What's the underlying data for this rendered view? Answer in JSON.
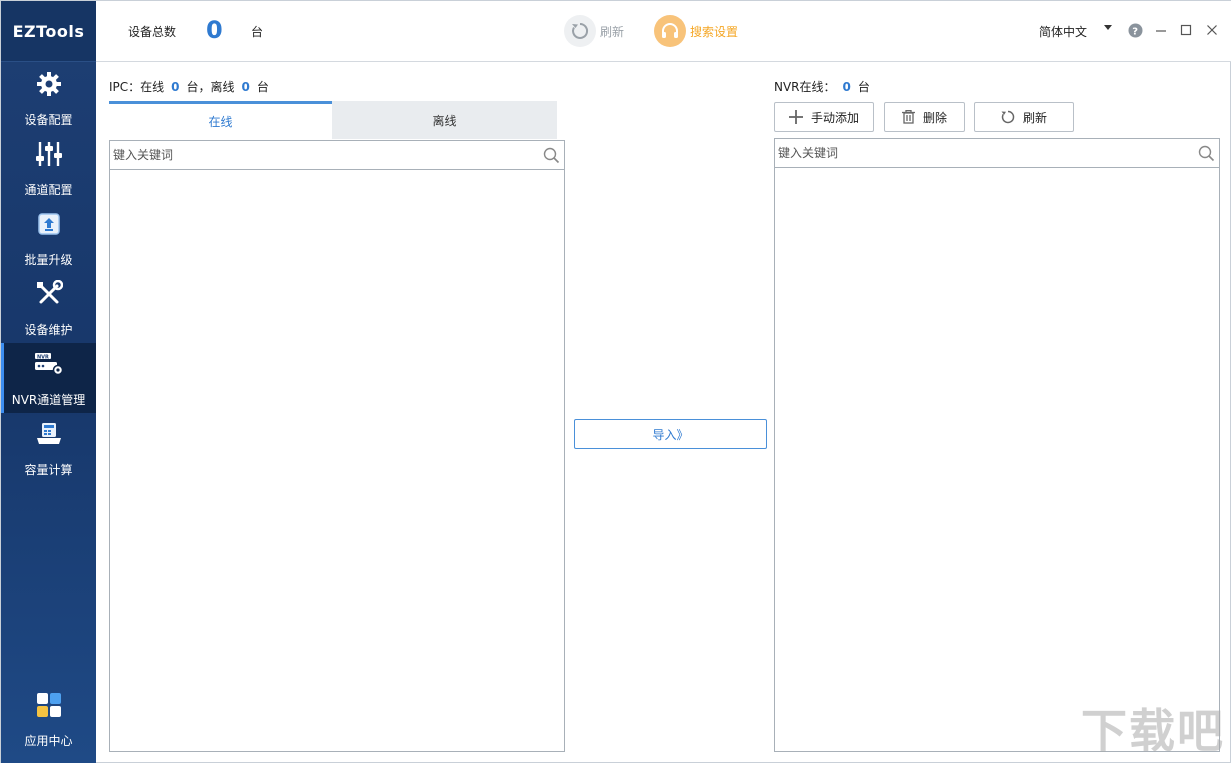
{
  "app": {
    "logo": "EZTools"
  },
  "sidebar": {
    "items": [
      {
        "label": "设备配置",
        "icon": "gear-icon"
      },
      {
        "label": "通道配置",
        "icon": "sliders-icon"
      },
      {
        "label": "批量升级",
        "icon": "upgrade-icon"
      },
      {
        "label": "设备维护",
        "icon": "tools-icon"
      },
      {
        "label": "NVR通道管理",
        "icon": "nvr-icon",
        "active": true
      },
      {
        "label": "容量计算",
        "icon": "calculator-icon"
      }
    ],
    "bottom_item": {
      "label": "应用中心",
      "icon": "apps-icon"
    }
  },
  "topbar": {
    "total_label": "设备总数",
    "total_count": "0",
    "unit": "台",
    "refresh_label": "刷新",
    "search_settings_label": "搜索设置",
    "language": "简体中文"
  },
  "ipc": {
    "prefix": "IPC：在线",
    "online_count": "0",
    "middle": "台，离线",
    "offline_count": "0",
    "unit": "台",
    "tabs": [
      "在线",
      "离线"
    ],
    "search_placeholder": "键入关键词"
  },
  "import_button": "导入》",
  "nvr": {
    "prefix": "NVR在线：",
    "online_count": "0",
    "unit": "台",
    "add_label": "手动添加",
    "delete_label": "删除",
    "refresh_label": "刷新",
    "search_placeholder": "键入关键词"
  },
  "watermark": "下载吧",
  "colors": {
    "accent": "#2f7ad0",
    "orange": "#f5a623",
    "sidebar": "#1e3f74"
  }
}
